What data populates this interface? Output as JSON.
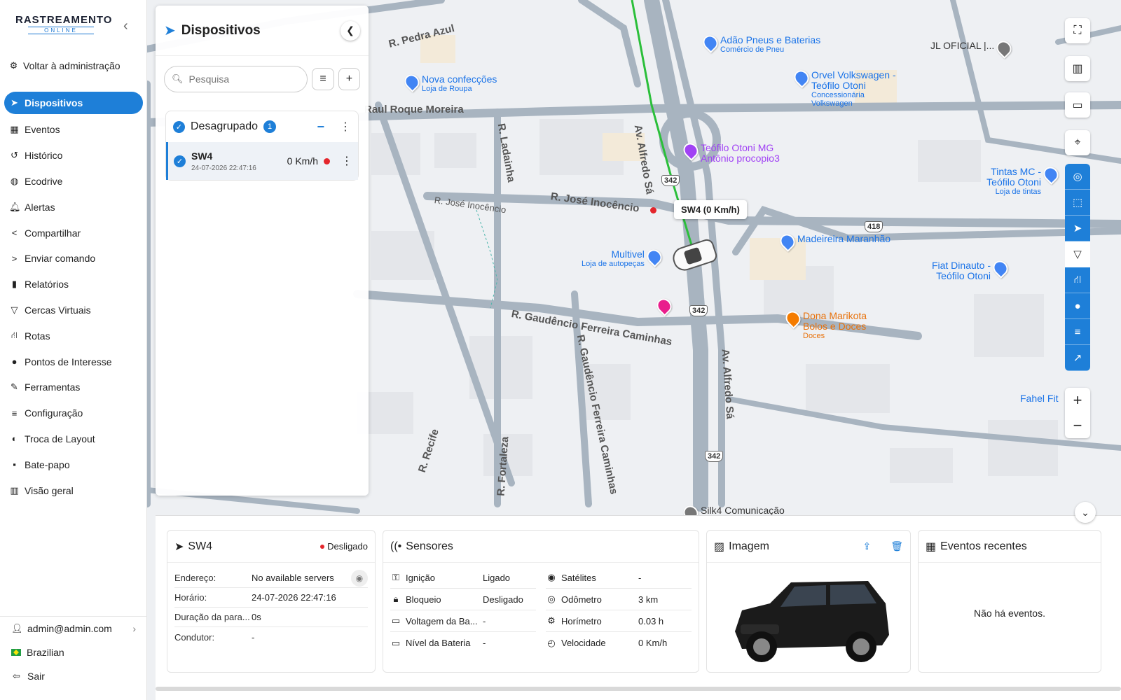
{
  "brand": {
    "main": "RASTREAMENTO",
    "sub": "ONLINE"
  },
  "sidebar": {
    "admin_link": "Voltar à administração",
    "items": [
      {
        "label": "Dispositivos",
        "icon": "navigation-arrow-icon",
        "active": true
      },
      {
        "label": "Eventos",
        "icon": "calendar-icon"
      },
      {
        "label": "Histórico",
        "icon": "history-icon"
      },
      {
        "label": "Ecodrive",
        "icon": "gauge-icon"
      },
      {
        "label": "Alertas",
        "icon": "bell-icon"
      },
      {
        "label": "Compartilhar",
        "icon": "share-icon"
      },
      {
        "label": "Enviar comando",
        "icon": "send-icon"
      },
      {
        "label": "Relatórios",
        "icon": "bar-chart-icon"
      },
      {
        "label": "Cercas Virtuais",
        "icon": "geofence-icon"
      },
      {
        "label": "Rotas",
        "icon": "road-icon"
      },
      {
        "label": "Pontos de Interesse",
        "icon": "map-pin-icon"
      },
      {
        "label": "Ferramentas",
        "icon": "wrench-icon"
      },
      {
        "label": "Configuração",
        "icon": "sliders-icon"
      },
      {
        "label": "Troca de Layout",
        "icon": "palette-icon"
      },
      {
        "label": "Bate-papo",
        "icon": "chat-icon"
      },
      {
        "label": "Visão geral",
        "icon": "overview-chart-icon"
      }
    ],
    "user": "admin@admin.com",
    "language": "Brazilian",
    "logout": "Sair"
  },
  "devices_panel": {
    "title": "Dispositivos",
    "search_placeholder": "Pesquisa",
    "group": {
      "name": "Desagrupado",
      "count": "1"
    },
    "device": {
      "name": "SW4",
      "timestamp": "24-07-2026 22:47:16",
      "speed": "0 Km/h",
      "status_color": "#e4262c"
    }
  },
  "map": {
    "vehicle_label": "SW4 (0 Km/h)",
    "roads": [
      "R. Pedra Azul",
      "Raul Roque Moreira",
      "R. Ladainha",
      "R. José Inocêncio",
      "R. José Inocêncio",
      "Av. Alfredo Sá",
      "R. Gaudêncio Ferreira Caminhas",
      "R. Recife",
      "R. Fortaleza",
      "Av. Alfredo Sá",
      "R. Gaudêncio Ferreira Caminhas"
    ],
    "shields": [
      "342",
      "418",
      "342",
      "342"
    ],
    "pois": [
      {
        "name": "Adão Pneus e Baterias",
        "sub": "Comércio de Pneu"
      },
      {
        "name": "Nova confecções",
        "sub": "Loja de Roupa"
      },
      {
        "name": "Orvel Volkswagen - Teófilo Otoni",
        "sub": "Concessionária Volkswagen"
      },
      {
        "name": "JL OFICIAL |...",
        "sub": ""
      },
      {
        "name": "Teófilo Otoni MG Antônio procopio3",
        "sub": ""
      },
      {
        "name": "Tintas MC - Teófilo Otoni",
        "sub": "Loja de tintas"
      },
      {
        "name": "Madeireira Maranhão",
        "sub": ""
      },
      {
        "name": "Multivel",
        "sub": "Loja de autopeças"
      },
      {
        "name": "Fiat Dinauto - Teófilo Otoni",
        "sub": ""
      },
      {
        "name": "Dona Marikota Bolos e Doces",
        "sub": "Doces"
      },
      {
        "name": "Fahel Fit",
        "sub": ""
      },
      {
        "name": "Silk4 Comunicação",
        "sub": ""
      }
    ]
  },
  "bottom": {
    "device_card": {
      "name": "SW4",
      "status": "Desligado",
      "rows": [
        {
          "k": "Endereço:",
          "v": "No available servers"
        },
        {
          "k": "Horário:",
          "v": "24-07-2026 22:47:16"
        },
        {
          "k": "Duração da para...",
          "v": "0s"
        },
        {
          "k": "Condutor:",
          "v": "-"
        }
      ]
    },
    "sensors": {
      "title": "Sensores",
      "left": [
        {
          "k": "Ignição",
          "v": "Ligado",
          "icon": "key-icon"
        },
        {
          "k": "Bloqueio",
          "v": "Desligado",
          "icon": "lock-icon"
        },
        {
          "k": "Voltagem da Ba...",
          "v": "-",
          "icon": "battery-icon"
        },
        {
          "k": "Nível da Bateria",
          "v": "-",
          "icon": "battery-level-icon"
        }
      ],
      "right": [
        {
          "k": "Satélites",
          "v": "-",
          "icon": "satellite-icon"
        },
        {
          "k": "Odômetro",
          "v": "3 km",
          "icon": "odometer-icon"
        },
        {
          "k": "Horímetro",
          "v": "0.03 h",
          "icon": "engine-hours-icon"
        },
        {
          "k": "Velocidade",
          "v": "0 Km/h",
          "icon": "speedometer-icon"
        }
      ]
    },
    "image_card": {
      "title": "Imagem"
    },
    "events_card": {
      "title": "Eventos recentes",
      "empty": "Não há eventos."
    }
  },
  "colors": {
    "accent": "#1e7fd8",
    "status_off": "#e4262c",
    "route": "#2bbf3a"
  }
}
